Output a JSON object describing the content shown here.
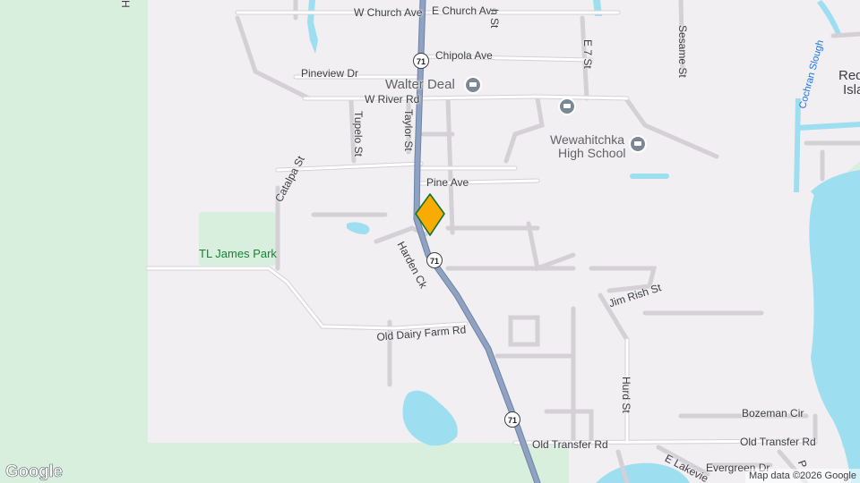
{
  "map": {
    "logo": "Google",
    "attribution": "Map data ©2026 Google",
    "colors": {
      "land": "#f2eff3",
      "park": "#d8efdd",
      "water": "#9ddff0",
      "road": "#ffffff",
      "road_casing": "#d4d0d6",
      "highway": "#8fa2c2",
      "highway_casing": "#6d82a6",
      "marker": "#f9ab00",
      "marker_outline": "#137333"
    },
    "route_shields": [
      "71",
      "71",
      "71"
    ],
    "poi": {
      "walter_deal": "Walter Deal",
      "school_name_line1": "Wewahitchka",
      "school_name_line2": "High School",
      "school_icon": "graduation-cap-icon",
      "civic_icon": "government-building-icon"
    },
    "parks": {
      "tl_james": "TL James Park"
    },
    "water": {
      "cochran_slough": "Cochran Slough"
    },
    "places": {
      "red_island_l1": "Red",
      "red_island_l2": "Isla"
    },
    "streets": {
      "w_church": "W Church Ave",
      "e_church": "E Church Ave",
      "chipola": "Chipola Ave",
      "pineview": "Pineview Dr",
      "w_river": "W River Rd",
      "tupelo": "Tupelo St",
      "taylor": "Taylor St",
      "e7": "E 7 St",
      "sesame": "Sesame St",
      "catalpa": "Catalpa St",
      "pine": "Pine Ave",
      "harden": "Harden Ck",
      "jim_rish": "Jim Rish St",
      "old_dairy": "Old Dairy Farm Rd",
      "hurd": "Hurd St",
      "bozeman": "Bozeman Cir",
      "old_transfer_w": "Old Transfer Rd",
      "old_transfer_e": "Old Transfer Rd",
      "evergreen": "Evergreen Dr",
      "e_lakeview": "E Lakevie",
      "h_partial": "H",
      "th_st_partial": "h St",
      "p_partial": "P"
    }
  }
}
